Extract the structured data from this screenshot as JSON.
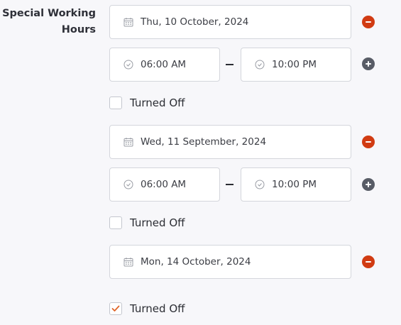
{
  "section": {
    "label": "Special Working Hours"
  },
  "entries": [
    {
      "date": "Thu, 10 October, 2024",
      "start_time": "06:00 AM",
      "end_time": "10:00 PM",
      "turned_off_label": "Turned Off",
      "turned_off": false
    },
    {
      "date": "Wed, 11 September, 2024",
      "start_time": "06:00 AM",
      "end_time": "10:00 PM",
      "turned_off_label": "Turned Off",
      "turned_off": false
    },
    {
      "date": "Mon, 14 October, 2024",
      "turned_off_label": "Turned Off",
      "turned_off": true
    }
  ],
  "icons": {
    "date": "calendar-icon",
    "time": "clock-icon",
    "remove": "minus-circle-icon",
    "add": "plus-circle-icon",
    "check": "checkmark-icon"
  },
  "colors": {
    "remove": "#d13b12",
    "add": "#585c66",
    "check": "#e0662a",
    "border": "#d4d6dc"
  }
}
